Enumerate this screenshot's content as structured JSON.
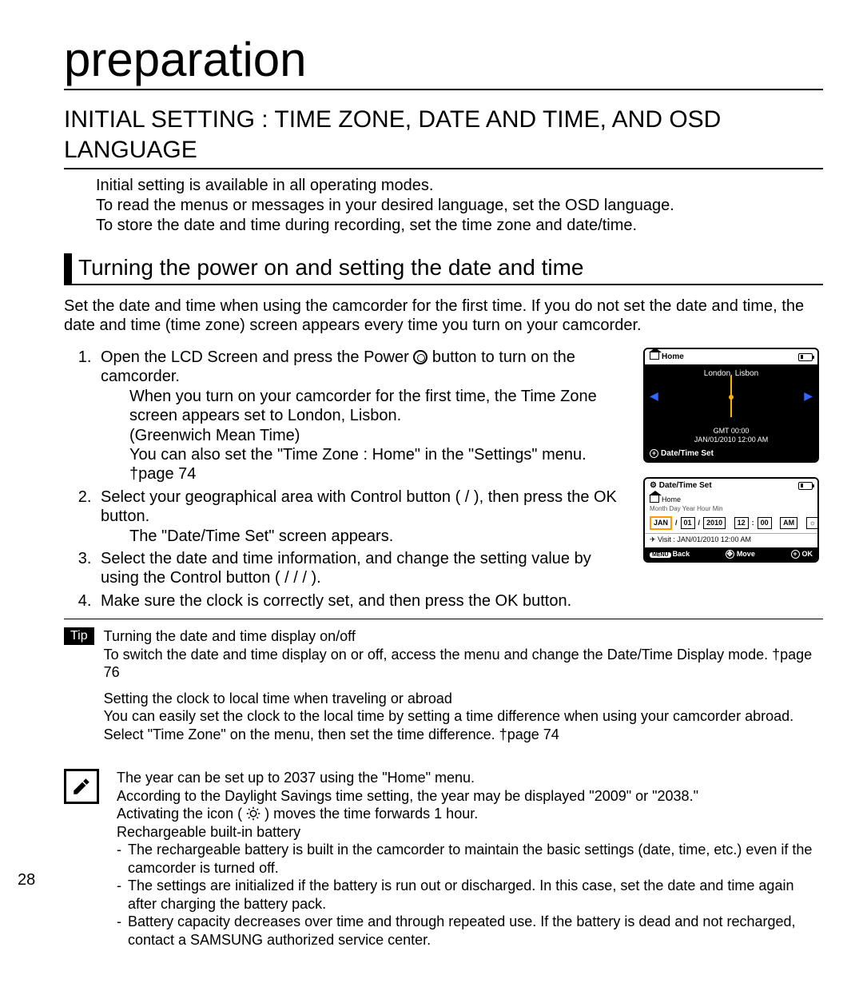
{
  "page_number": "28",
  "h1": "preparation",
  "h2": "INITIAL SETTING : TIME ZONE, DATE AND TIME, AND OSD LANGUAGE",
  "intro_l1": "Initial setting is available in all operating modes.",
  "intro_l2": "To read the menus or messages in your desired language, set the OSD language.",
  "intro_l3": "To store the date and time during recording, set the time zone and date/time.",
  "h3": "Turning the power on and setting the date and time",
  "body1": "Set the date and time when using the camcorder for the ﬁrst time. If you do not set the date and time, the date and time (time zone) screen appears every time you turn on your camcorder.",
  "step1a": "Open the LCD Screen and press the Power",
  "step1b": " button to turn on the camcorder.",
  "step1_i1": "When you turn on your camcorder for the ﬁrst time, the Time Zone screen appears set to London, Lisbon.",
  "step1_i2": "(Greenwich Mean Time)",
  "step1_i3": "You can also set the \"Time Zone  : Home\" in the \"Settings\" menu. †page 74",
  "step2": "Select your geographical area with Control button (    /    ), then press the OK button.",
  "step2_i1": "The \"Date/Time Set\" screen appears.",
  "step3": "Select the date and time information, and change the setting value by using the Control button (    /    /    /    ).",
  "step4": "Make sure the clock is correctly set, and then press the OK button.",
  "tip_label": "Tip",
  "tip_p1_t": "Turning the date and time display on/off",
  "tip_p1": "To switch the date and time display on or off, access the menu and change the Date/Time Display mode. †page 76",
  "tip_p2_t": "Setting the clock to local time when traveling or abroad",
  "tip_p2": "You can easily set the clock to the local time by setting a time difference when using your camcorder abroad. Select \"Time Zone\" on the menu, then set the time difference. †page 74",
  "note_l1": "The year can be set up to 2037 using the \"Home\" menu.",
  "note_l2": "According to the Daylight Savings time setting, the year may be displayed \"2009\" or \"2038.\"",
  "note_l3a": "Activating the icon (",
  "note_l3b": ") moves the time forwards 1 hour.",
  "note_l4": "Rechargeable built-in battery",
  "note_b1": "The rechargeable battery is built in the camcorder to maintain the basic settings (date, time, etc.) even if the camcorder is turned off.",
  "note_b2": "The settings are initialized if the battery is run out or discharged. In this case, set the date and time again after charging the battery pack.",
  "note_b3": "Battery capacity decreases over time and through repeated use. If the battery is dead and not recharged, contact a SAMSUNG authorized service center.",
  "lcd1": {
    "title": "Home",
    "city": "London, Lisbon",
    "gmt": "GMT 00:00",
    "dt": "JAN/01/2010 12:00 AM",
    "footer": "Date/Time Set"
  },
  "lcd2": {
    "title": "Date/Time Set",
    "home": "Home",
    "labels": "Month  Day   Year  Hour  Min",
    "f_month": "JAN",
    "f_day": "01",
    "f_year": "2010",
    "f_hour": "12",
    "f_min": "00",
    "f_ampm": "AM",
    "visit": "Visit   : JAN/01/2010 12:00 AM",
    "back": "Back",
    "move": "Move",
    "ok": "OK"
  }
}
